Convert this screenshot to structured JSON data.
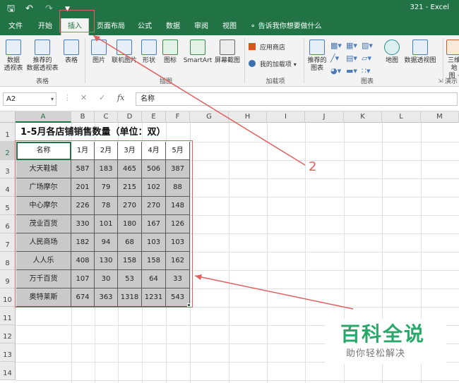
{
  "title_bar": {
    "save_icon": "save-icon",
    "undo_icon": "undo-icon",
    "redo_icon": "redo-icon",
    "title": "321  -  Excel"
  },
  "tabs": [
    "文件",
    "开始",
    "插入",
    "页面布局",
    "公式",
    "数据",
    "审阅",
    "视图"
  ],
  "active_tab": "插入",
  "tell_me": "告诉我你想要做什么",
  "ribbon": {
    "tables": {
      "pivot": "数据\n透视表",
      "rec_pivot": "推荐的\n数据透视表",
      "table": "表格",
      "group": "表格"
    },
    "illustrations": {
      "pictures": "图片",
      "online_pictures": "联机图片",
      "shapes": "形状",
      "icons": "图标",
      "smartart": "SmartArt",
      "screenshot": "屏幕截图",
      "group": "插图"
    },
    "addins": {
      "store": "应用商店",
      "my_addins": "我的加载项",
      "group": "加载项"
    },
    "charts": {
      "recommended": "推荐的\n图表",
      "map": "地图",
      "pivot_chart": "数据透视图",
      "group": "图表"
    },
    "tours": {
      "label": "三维地\n图 ·",
      "group": "演示"
    }
  },
  "formula_bar": {
    "name_box": "A2",
    "formula": "名称"
  },
  "columns": [
    "A",
    "B",
    "C",
    "D",
    "E",
    "F",
    "G",
    "H",
    "I",
    "J",
    "K",
    "L",
    "M"
  ],
  "rows": [
    "1",
    "2",
    "3",
    "4",
    "5",
    "6",
    "7",
    "8",
    "9",
    "10",
    "11",
    "12",
    "13",
    "14"
  ],
  "sheet": {
    "title": "1-5月各店铺销售数量（单位：双）",
    "headers": [
      "名称",
      "1月",
      "2月",
      "3月",
      "4月",
      "5月"
    ],
    "data": [
      [
        "大天鞋城",
        "587",
        "183",
        "465",
        "506",
        "387"
      ],
      [
        "广场摩尔",
        "201",
        "79",
        "215",
        "102",
        "88"
      ],
      [
        "中心摩尔",
        "226",
        "78",
        "270",
        "270",
        "148"
      ],
      [
        "茂业百货",
        "330",
        "101",
        "180",
        "167",
        "126"
      ],
      [
        "人民商场",
        "182",
        "94",
        "68",
        "103",
        "103"
      ],
      [
        "人人乐",
        "408",
        "130",
        "158",
        "158",
        "162"
      ],
      [
        "万千百货",
        "107",
        "30",
        "53",
        "64",
        "33"
      ],
      [
        "奥特莱斯",
        "674",
        "363",
        "1318",
        "1231",
        "543"
      ]
    ]
  },
  "annotation": "2",
  "watermark": {
    "main": "百科全说",
    "sub": "助你轻松解决"
  },
  "colors": {
    "excel_green": "#217346",
    "annotation_red": "#e06060",
    "table_fill": "#c9c9c9",
    "watermark_green": "#2aa86a"
  }
}
